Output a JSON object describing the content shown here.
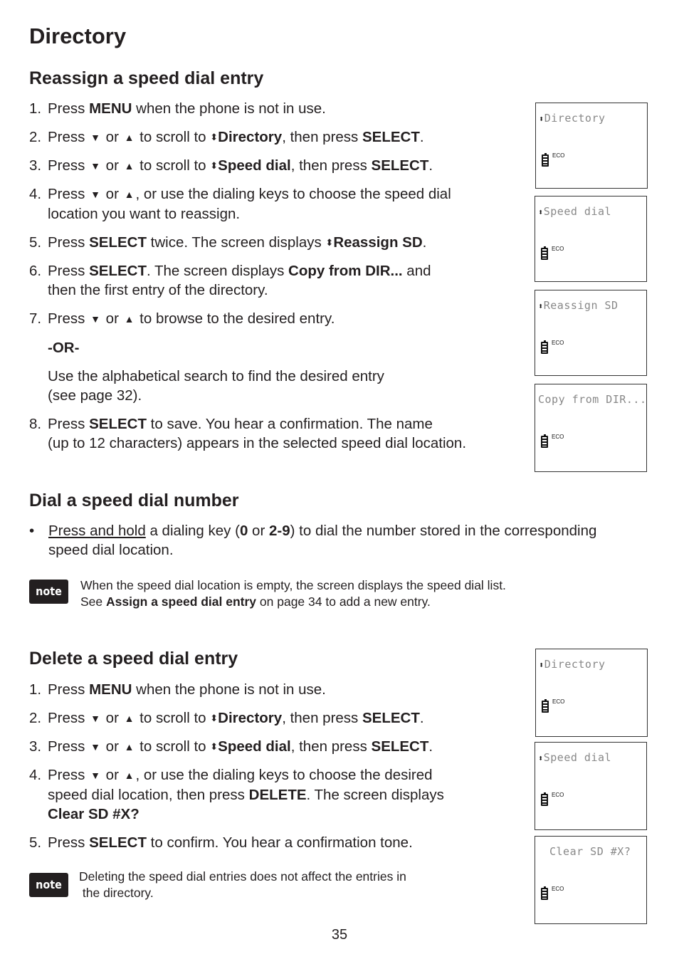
{
  "page": {
    "title": "Directory",
    "page_number": "35"
  },
  "reassign": {
    "heading": "Reassign a speed dial entry",
    "steps": [
      {
        "num": "1.",
        "parts": [
          "Press ",
          "MENU",
          " when the phone is not in use."
        ]
      },
      {
        "num": "2.",
        "parts": [
          "Press ",
          "▼",
          " or ",
          "▲",
          " to scroll to ",
          "⬍",
          "Directory",
          ", then press ",
          "SELECT",
          "."
        ]
      },
      {
        "num": "3.",
        "parts": [
          "Press ",
          "▼",
          " or ",
          "▲",
          " to scroll to ",
          "⬍",
          "Speed dial",
          ", then press ",
          "SELECT",
          "."
        ]
      },
      {
        "num": "4.",
        "line1": ", or use the dialing keys to choose the speed dial",
        "line2": "location you want to reassign."
      },
      {
        "num": "5.",
        "pre": "Press ",
        "b1": "SELECT",
        "mid": " twice. The screen displays ",
        "b2": "Reassign SD",
        "post": "."
      },
      {
        "num": "6.",
        "pre": "Press ",
        "b1": "SELECT",
        "mid": ". The screen displays ",
        "b2": "Copy from DIR...",
        "post": " and",
        "line2": "then the first entry of the directory."
      },
      {
        "num": "7.",
        "pre": "Press ",
        "mid": " to browse to the desired entry."
      },
      {
        "num": "8.",
        "pre": "Press ",
        "b1": "SELECT",
        "mid": " to save. You hear a confirmation. The name",
        "line2": "(up to 12 characters) appears in the selected speed dial location."
      }
    ],
    "or_label": "-OR-",
    "alt_line1": "Use the alphabetical search to find the desired entry",
    "alt_line2": "(see page 32).",
    "screens": [
      {
        "text": "Directory",
        "arrows": true,
        "status": "ECO"
      },
      {
        "text": "Speed dial",
        "arrows": true,
        "status": "ECO"
      },
      {
        "text": "Reassign SD",
        "arrows": true,
        "status": "ECO"
      },
      {
        "text": "Copy from DIR...",
        "arrows": false,
        "status": "ECO"
      }
    ]
  },
  "dial": {
    "heading": "Dial a speed dial number",
    "bullet_u": "Press and hold",
    "bullet_a": " a dialing key (",
    "key0": "0",
    "or": " or ",
    "key29": "2-9",
    "bullet_b": ") to dial the number stored in the corresponding",
    "bullet_line2": "speed dial location.",
    "note_label": "note",
    "note_line1": "When the speed dial location is empty, the screen displays the speed dial list.",
    "note_pre": "See ",
    "note_bold": "Assign a speed dial entry",
    "note_post": " on page 34 to add a new entry."
  },
  "delete": {
    "heading": "Delete a speed dial entry",
    "s1": {
      "num": "1.",
      "pre": "Press ",
      "b": "MENU",
      "post": " when the phone is not in use."
    },
    "s2": {
      "num": "2.",
      "b": "Directory"
    },
    "s3": {
      "num": "3.",
      "b": "Speed dial"
    },
    "s4": {
      "num": "4.",
      "line1": ", or use the dialing keys to choose the desired",
      "line2_pre": "speed dial location, then press ",
      "line2_b": "DELETE",
      "line2_post": ". The screen displays",
      "line3_b": "Clear SD #X?"
    },
    "s5": {
      "num": "5.",
      "pre": "Press ",
      "b": "SELECT",
      "post": " to confirm. You hear a confirmation tone."
    },
    "note_label": "note",
    "note_line1": "Deleting the speed dial entries does not affect the entries in",
    "note_line2": "the directory.",
    "screens": [
      {
        "text": "Directory",
        "arrows": true,
        "status": "ECO"
      },
      {
        "text": "Speed dial",
        "arrows": true,
        "status": "ECO"
      },
      {
        "text": "Clear SD #X?",
        "arrows": false,
        "status": "ECO"
      }
    ]
  },
  "common": {
    "press": "Press ",
    "or": " or ",
    "scroll_to": " to scroll to ",
    "then_press": ", then press ",
    "select": "SELECT",
    "period": ".",
    "down": "▼",
    "up": "▲",
    "updown": "⬍"
  }
}
